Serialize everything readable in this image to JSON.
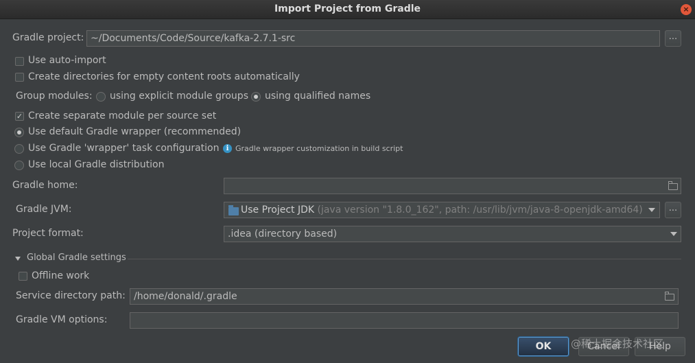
{
  "window": {
    "title": "Import Project from Gradle",
    "close": "×"
  },
  "gradle_project": {
    "label": "Gradle project:",
    "value": "~/Documents/Code/Source/kafka-2.7.1-src",
    "browse": "..."
  },
  "options": {
    "auto_import": {
      "label": "Use auto-import",
      "checked": false
    },
    "create_dirs": {
      "label": "Create directories for empty content roots automatically",
      "checked": false
    },
    "group_modules": {
      "label": "Group modules:",
      "explicit": "using explicit module groups",
      "qualified": "using qualified names",
      "selected": "qualified"
    },
    "separate_module": {
      "label": "Create separate module per source set",
      "checked": true
    },
    "default_wrapper": {
      "label": "Use default Gradle wrapper (recommended)",
      "selected": true
    },
    "wrapper_task": {
      "label": "Use Gradle 'wrapper' task configuration",
      "hint": "Gradle wrapper customization in build script"
    },
    "local_dist": {
      "label": "Use local Gradle distribution"
    }
  },
  "gradle_home": {
    "label": "Gradle home:",
    "value": ""
  },
  "gradle_jvm": {
    "label": "Gradle JVM:",
    "value": "Use Project JDK",
    "detail": "(java version \"1.8.0_162\", path: /usr/lib/jvm/java-8-openjdk-amd64)",
    "browse": "..."
  },
  "project_format": {
    "label": "Project format:",
    "value": ".idea (directory based)"
  },
  "global_settings": {
    "title": "Global Gradle settings",
    "offline": {
      "label": "Offline work",
      "checked": false
    },
    "service_dir": {
      "label": "Service directory path:",
      "value": "/home/donald/.gradle"
    },
    "vm_options": {
      "label": "Gradle VM options:",
      "value": ""
    }
  },
  "buttons": {
    "ok": "OK",
    "cancel": "Cancel",
    "help": "Help"
  },
  "watermark": "@稀土掘金技术社区",
  "colors": {
    "background": "#3c3f41",
    "accent": "#5a9cd3",
    "info": "#3592c4"
  }
}
